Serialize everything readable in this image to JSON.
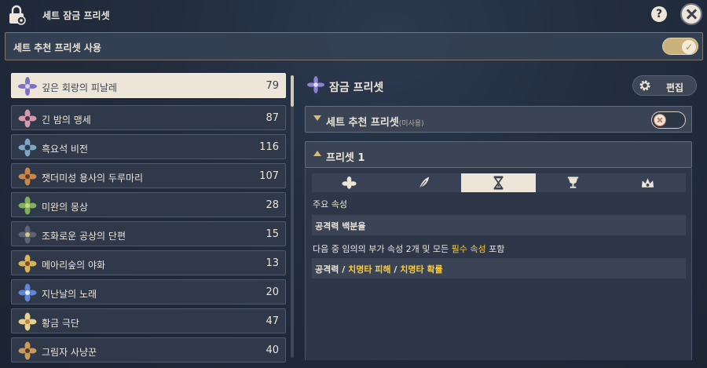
{
  "header": {
    "title": "세트 잠금 프리셋",
    "help_label": "?"
  },
  "use_row": {
    "label": "세트 추천 프리셋 사용",
    "enabled": true,
    "check": "✓"
  },
  "sets": [
    {
      "name": "깊은 회랑의 피날레",
      "count": "79",
      "selected": true,
      "icon": "violet-flower-icon"
    },
    {
      "name": "긴 밤의 맹세",
      "count": "87",
      "icon": "pink-flower-icon"
    },
    {
      "name": "흑요석 비전",
      "count": "116",
      "icon": "obsidian-flower-icon"
    },
    {
      "name": "잿더미성 용사의 두루마리",
      "count": "107",
      "icon": "scroll-flower-icon"
    },
    {
      "name": "미완의 몽상",
      "count": "28",
      "icon": "green-flower-icon"
    },
    {
      "name": "조화로운 공상의 단편",
      "count": "15",
      "icon": "dark-flower-icon"
    },
    {
      "name": "메아리숲의 야화",
      "count": "13",
      "icon": "gold-flower-icon"
    },
    {
      "name": "지난날의 노래",
      "count": "20",
      "icon": "blue-flower-icon"
    },
    {
      "name": "황금 극단",
      "count": "47",
      "icon": "golden-flower-icon"
    },
    {
      "name": "그림자 사냥꾼",
      "count": "40",
      "icon": "hunter-flower-icon"
    }
  ],
  "detail": {
    "title": "잠금 프리셋",
    "edit_label": "편집",
    "recommend_section": {
      "title": "세트 추천 프리셋",
      "subtitle": "(미사용)",
      "enabled": false
    },
    "preset_section": {
      "title": "프리셋 1"
    },
    "tabs": [
      {
        "icon": "flower-icon",
        "active": false
      },
      {
        "icon": "feather-icon",
        "active": false
      },
      {
        "icon": "hourglass-icon",
        "active": true
      },
      {
        "icon": "goblet-icon",
        "active": false
      },
      {
        "icon": "crown-icon",
        "active": false
      }
    ],
    "main_stat_label": "주요 속성",
    "main_stat_value": "공격력 백분율",
    "sub_rule": {
      "prefix": "다음 중 임의의 부가 속성 2개 및 모든",
      "highlight": "필수 속성",
      "suffix": "포함"
    },
    "sub_stats": {
      "first": "공격력",
      "sep": "/",
      "second": "치명타 피해",
      "third": "치명타 확률"
    }
  },
  "colors": {
    "accent_gold": "#ffcc33",
    "cream": "#ece5d8",
    "panel": "#3a4455"
  }
}
